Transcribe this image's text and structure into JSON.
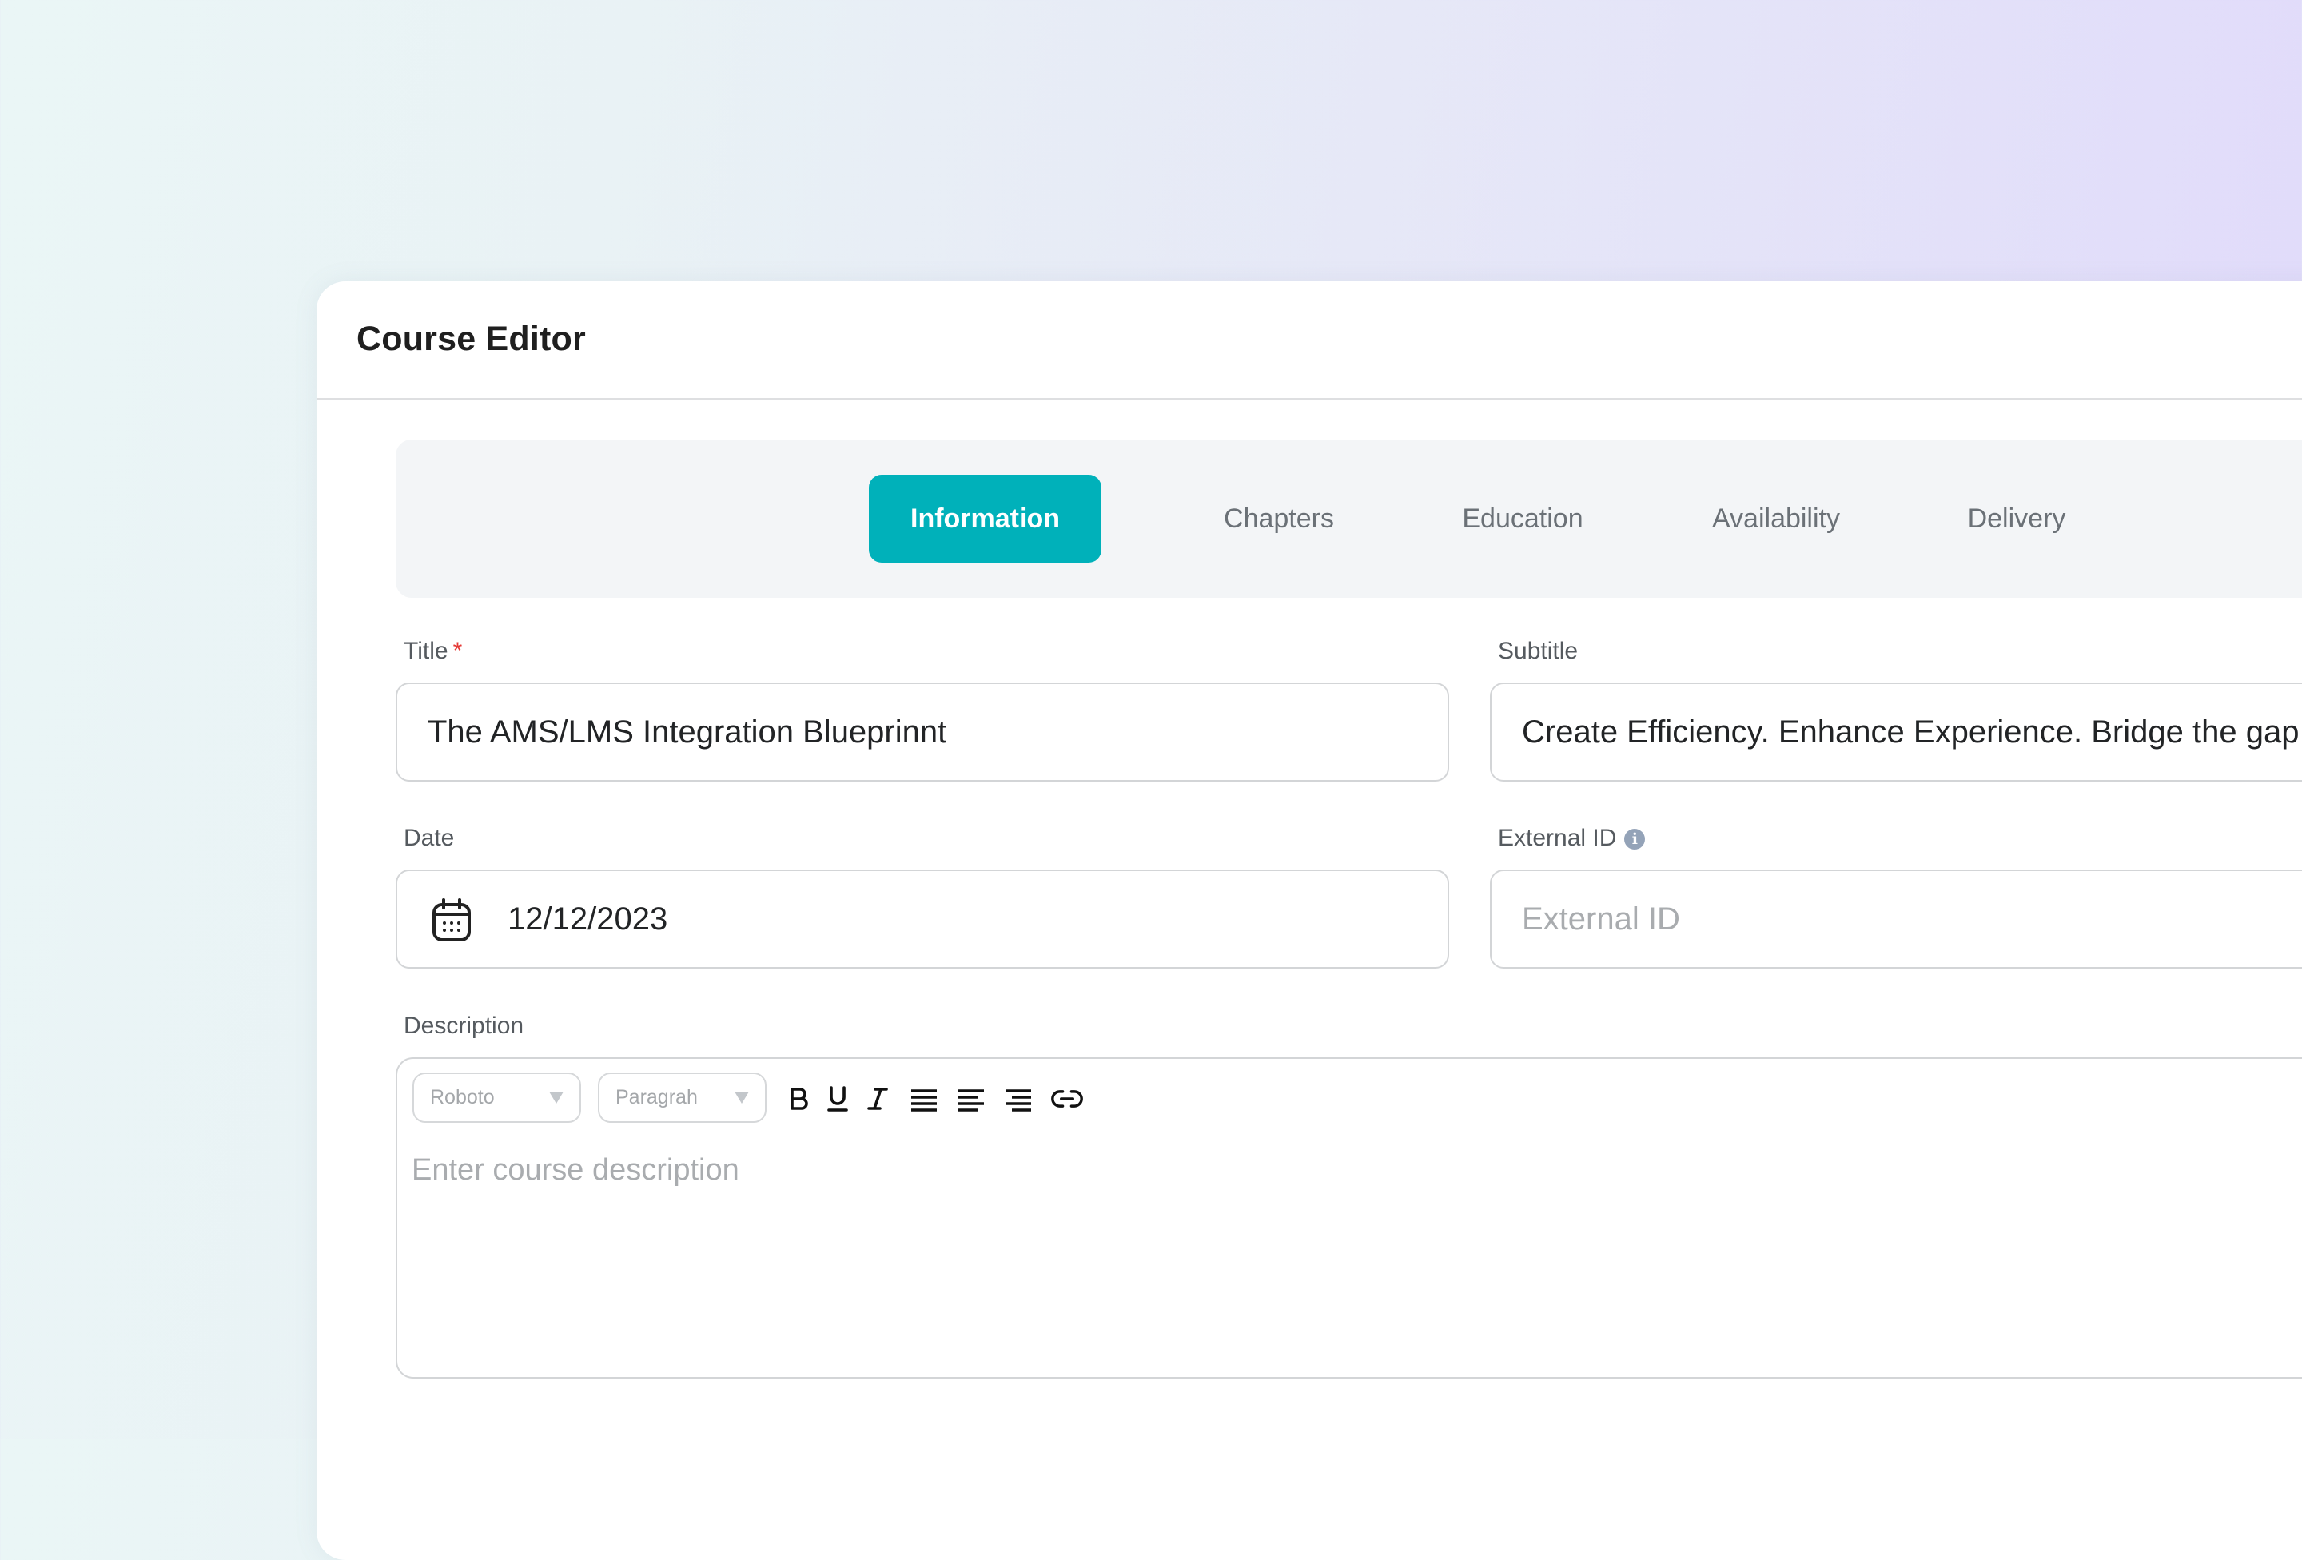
{
  "header": {
    "title": "Course Editor"
  },
  "tabs": [
    {
      "label": "Information",
      "active": true
    },
    {
      "label": "Chapters",
      "active": false
    },
    {
      "label": "Education",
      "active": false
    },
    {
      "label": "Availability",
      "active": false
    },
    {
      "label": "Delivery",
      "active": false
    }
  ],
  "colors": {
    "accent": "#00B1BA",
    "required": "#E53935",
    "info_icon": "#94A3B8"
  },
  "form": {
    "title": {
      "label": "Title",
      "required_mark": "*",
      "value": "The AMS/LMS Integration Blueprinnt"
    },
    "subtitle": {
      "label": "Subtitle",
      "value": "Create Efficiency. Enhance Experience. Bridge the gap"
    },
    "date": {
      "label": "Date",
      "value": "12/12/2023",
      "icon": "calendar-icon"
    },
    "external_id": {
      "label": "External ID",
      "info_icon": "i",
      "placeholder": "External ID"
    },
    "description": {
      "label": "Description",
      "font_select": "Roboto",
      "block_select": "Paragrah",
      "toolbar": [
        "bold",
        "underline",
        "italic",
        "align-justify",
        "align-left",
        "align-right",
        "link"
      ],
      "placeholder": "Enter course description"
    }
  }
}
